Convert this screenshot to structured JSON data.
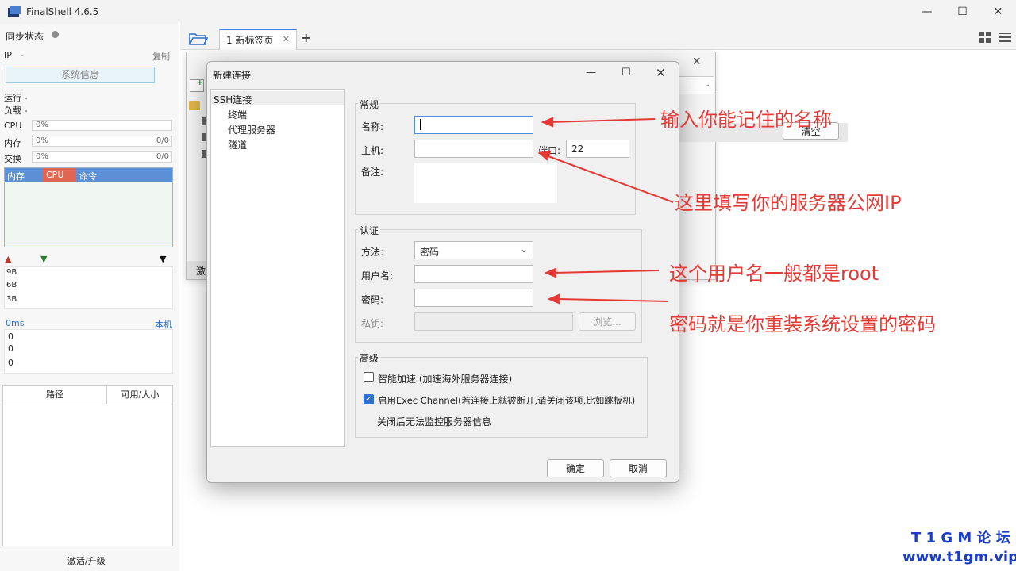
{
  "window": {
    "title": "FinalShell 4.6.5",
    "minimize": "—",
    "maximize": "☐",
    "close": "✕"
  },
  "sidebar": {
    "sync_label": "同步状态",
    "ip_label": "IP",
    "ip_value": "-",
    "copy_label": "复制",
    "sysinfo_button": "系统信息",
    "run_label": "运行 -",
    "load_label": "负载 -",
    "cpu_label": "CPU",
    "cpu_value": "0%",
    "mem_label": "内存",
    "mem_value": "0%",
    "mem_count": "0/0",
    "swap_label": "交换",
    "swap_value": "0%",
    "swap_count": "0/0",
    "process_tabs": [
      "内存",
      "CPU",
      "命令"
    ],
    "net_ticks": [
      "9B",
      "6B",
      "3B"
    ],
    "latency_label": "0ms",
    "latency_host": "本机",
    "latency_ticks": [
      "0",
      "0",
      "0"
    ],
    "disk_cols": [
      "路径",
      "可用/大小"
    ],
    "activate_label": "激活/升级"
  },
  "tabs": [
    {
      "label": "1 新标签页"
    }
  ],
  "conn_manager": {
    "clear_button": "清空",
    "footer_label": "激"
  },
  "dialog": {
    "title": "新建连接",
    "tree": [
      "SSH连接",
      "终端",
      "代理服务器",
      "隧道"
    ],
    "general": {
      "title": "常规",
      "name_label": "名称:",
      "name_value": "",
      "host_label": "主机:",
      "host_value": "",
      "port_label": "端口:",
      "port_value": "22",
      "remark_label": "备注:"
    },
    "auth": {
      "title": "认证",
      "method_label": "方法:",
      "method_value": "密码",
      "user_label": "用户名:",
      "user_value": "",
      "password_label": "密码:",
      "key_label": "私钥:",
      "browse_button": "浏览..."
    },
    "advanced": {
      "title": "高级",
      "smart_accel_label": "智能加速 (加速海外服务器连接)",
      "smart_accel_checked": false,
      "exec_channel_label": "启用Exec Channel(若连接上就被断开,请关闭该项,比如跳板机)",
      "exec_channel_checked": true,
      "exec_note": "关闭后无法监控服务器信息"
    },
    "ok_button": "确定",
    "cancel_button": "取消"
  },
  "annotations": [
    "输入你能记住的名称",
    "这里填写你的服务器公网IP",
    "这个用户名一般都是root",
    "密码就是你重装系统设置的密码"
  ],
  "watermark": {
    "line1": "T 1 G M 论 坛",
    "line2": "www.t1gm.vip"
  },
  "colors": {
    "accent": "#3b7dd8",
    "annotation": "#e53935",
    "watermark": "#1a3cc8",
    "process_header": "#5b8fd6",
    "cpu_tab": "#e06651"
  }
}
